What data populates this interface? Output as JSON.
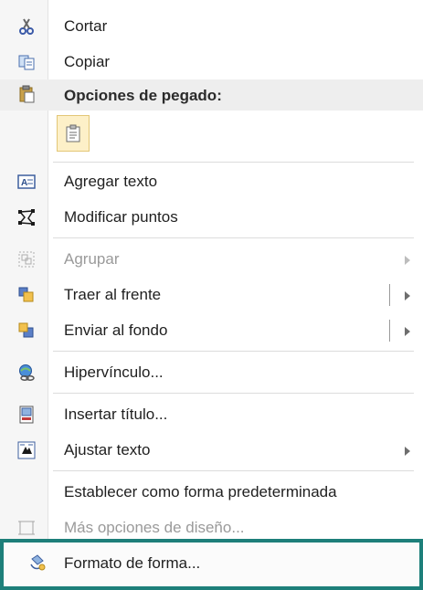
{
  "menu": {
    "items": {
      "cut": {
        "label": "Cortar",
        "icon": "scissors-icon"
      },
      "copy": {
        "label": "Copiar",
        "icon": "copy-icon"
      },
      "paste_options": {
        "label": "Opciones de pegado:",
        "icon": "paste-icon"
      },
      "paste_keep": {
        "icon": "paste-keep-format-icon"
      },
      "add_text": {
        "label": "Agregar texto",
        "icon": "text-box-icon"
      },
      "edit_points": {
        "label": "Modificar puntos",
        "icon": "edit-points-icon"
      },
      "group": {
        "label": "Agrupar",
        "icon": "group-icon",
        "disabled": true,
        "has_submenu": true
      },
      "bring_front": {
        "label": "Traer al frente",
        "icon": "bring-to-front-icon",
        "has_submenu": true
      },
      "send_back": {
        "label": "Enviar al fondo",
        "icon": "send-to-back-icon",
        "has_submenu": true
      },
      "hyperlink": {
        "label": "Hipervínculo...",
        "icon": "hyperlink-icon"
      },
      "insert_caption": {
        "label": "Insertar título...",
        "icon": "caption-icon"
      },
      "wrap_text": {
        "label": "Ajustar texto",
        "icon": "wrap-text-icon",
        "has_submenu": true
      },
      "set_default": {
        "label": "Establecer como forma predeterminada"
      },
      "more_layout": {
        "label": "Más opciones de diseño...",
        "icon": "layout-options-icon",
        "disabled": true
      },
      "format_shape": {
        "label": "Formato de forma...",
        "icon": "format-shape-icon"
      }
    }
  },
  "colors": {
    "highlight_border": "#1d7f7a",
    "gutter": "#f6f6f6",
    "disabled_text": "#9a9a9a"
  }
}
